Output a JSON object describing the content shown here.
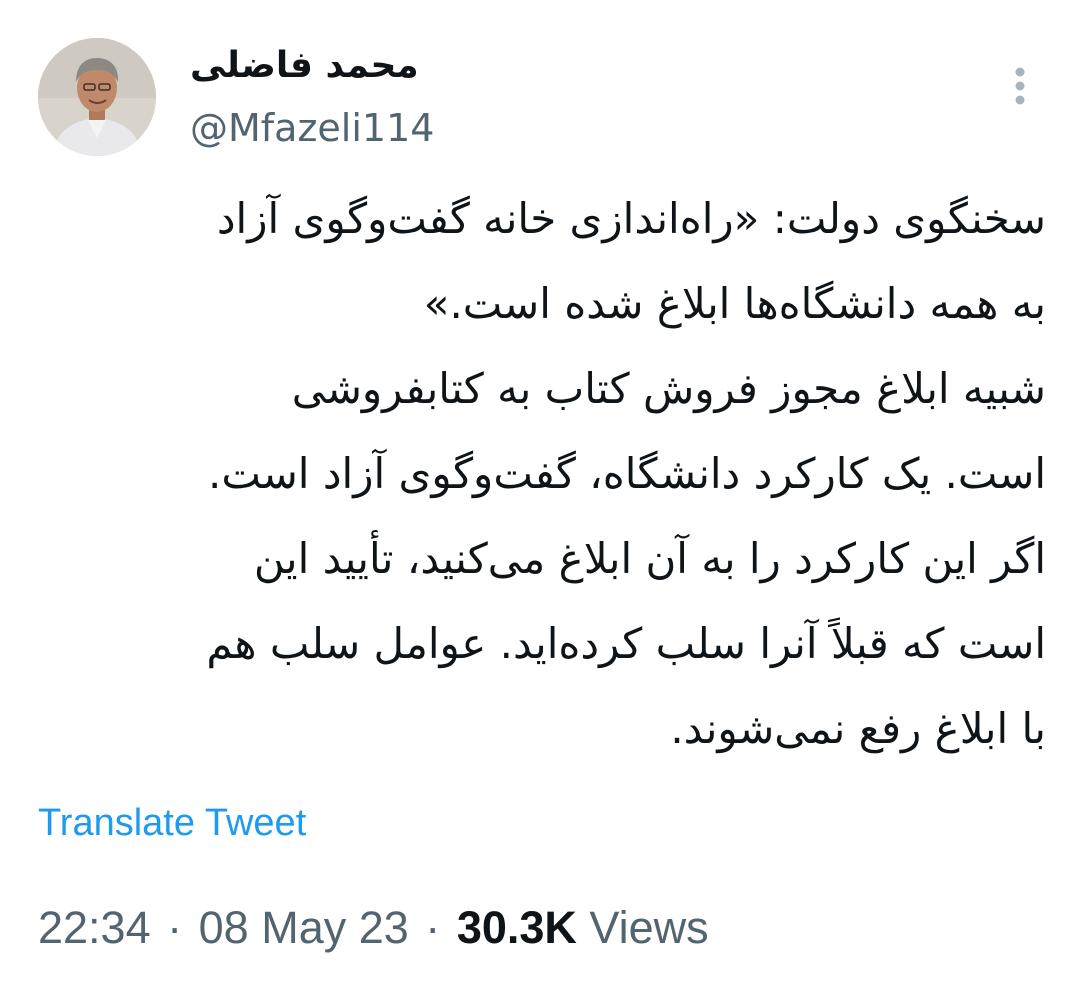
{
  "author": {
    "name": "محمد فاضلی",
    "handle": "@Mfazeli114"
  },
  "tweet": {
    "lines": [
      "سخنگوی دولت: «راه‌اندازی خانه گفت‌وگوی آزاد",
      "به همه دانشگاه‌ها ابلاغ شده است.»",
      "شبیه ابلاغ مجوز فروش کتاب به کتابفروشی",
      "است. یک کارکرد دانشگاه، گفت‌وگوی آزاد است.",
      "اگر این کارکرد را به آن ابلاغ می‌کنید، تأیید این",
      "است که قبلاً آنرا سلب کرده‌اید. عوامل سلب هم",
      "با ابلاغ رفع نمی‌شوند."
    ],
    "translate_label": "Translate Tweet"
  },
  "meta": {
    "time": "22:34",
    "separator": "·",
    "date": "08 May 23",
    "views_count": "30.3K",
    "views_label": "Views"
  },
  "icons": {
    "more": "more-vertical-icon",
    "avatar": "profile-photo"
  },
  "colors": {
    "text": "#0f1419",
    "secondary": "#536471",
    "link": "#1d9bf0"
  }
}
